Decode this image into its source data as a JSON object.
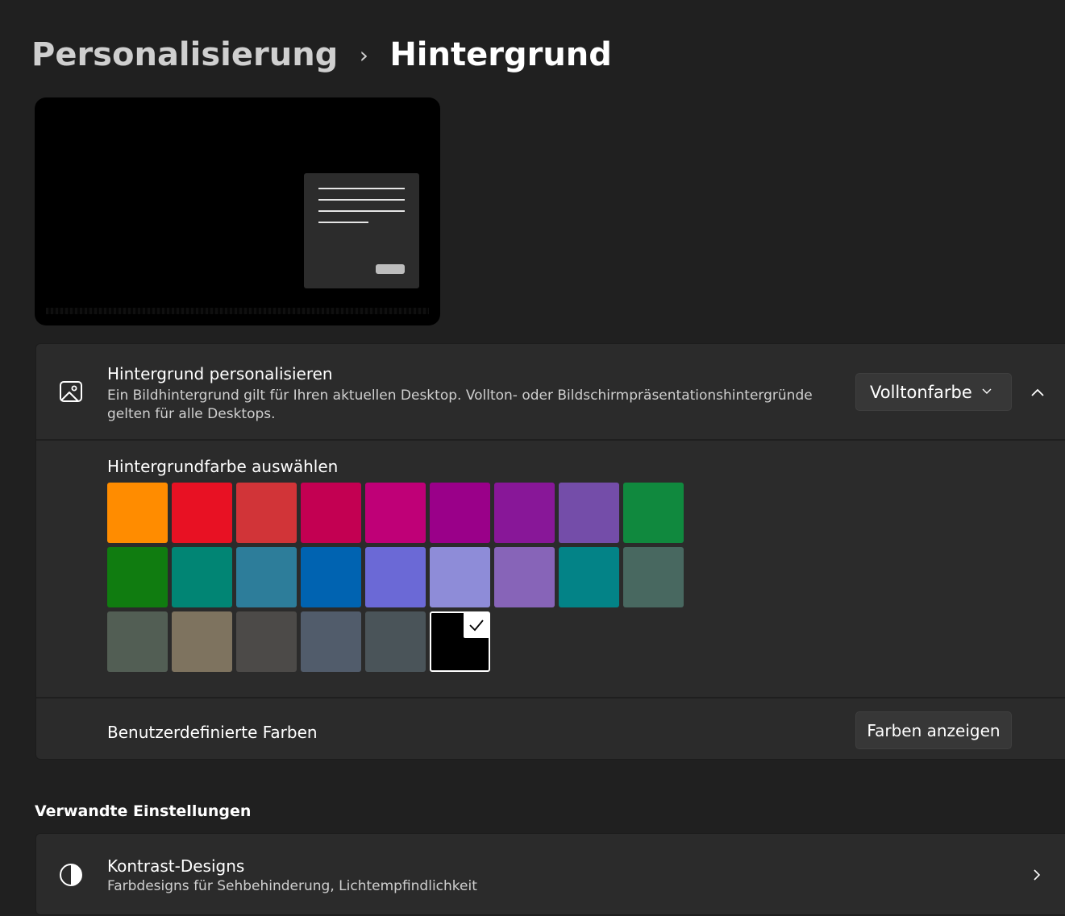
{
  "breadcrumb": {
    "parent": "Personalisierung",
    "separator": "›",
    "current": "Hintergrund"
  },
  "personalize": {
    "title": "Hintergrund personalisieren",
    "description": "Ein Bildhintergrund gilt für Ihren aktuellen Desktop. Vollton- oder Bildschirmpräsentationshintergründe gelten für alle Desktops.",
    "dropdown_value": "Volltonfarbe",
    "icon": "image-icon",
    "collapse_icon": "chevron-up-icon"
  },
  "colors": {
    "title": "Hintergrundfarbe auswählen",
    "selected_index": 23,
    "swatches": [
      "#ff8c00",
      "#e81123",
      "#d13438",
      "#c30052",
      "#bf0077",
      "#9a0089",
      "#881798",
      "#744da9",
      "#10893e",
      "#107c10",
      "#018574",
      "#2d7d9a",
      "#0063b1",
      "#6b69d6",
      "#8e8cd8",
      "#8764b8",
      "#038387",
      "#486860",
      "#525e54",
      "#7e735f",
      "#4c4a48",
      "#515c6b",
      "#4a5459",
      "#000000"
    ]
  },
  "custom": {
    "label": "Benutzerdefinierte Farben",
    "button_label": "Farben anzeigen"
  },
  "related": {
    "section_title": "Verwandte Einstellungen",
    "contrast_title": "Kontrast-Designs",
    "contrast_desc": "Farbdesigns für Sehbehinderung, Lichtempfindlichkeit",
    "icon": "contrast-icon",
    "chevron": "chevron-right-icon"
  }
}
